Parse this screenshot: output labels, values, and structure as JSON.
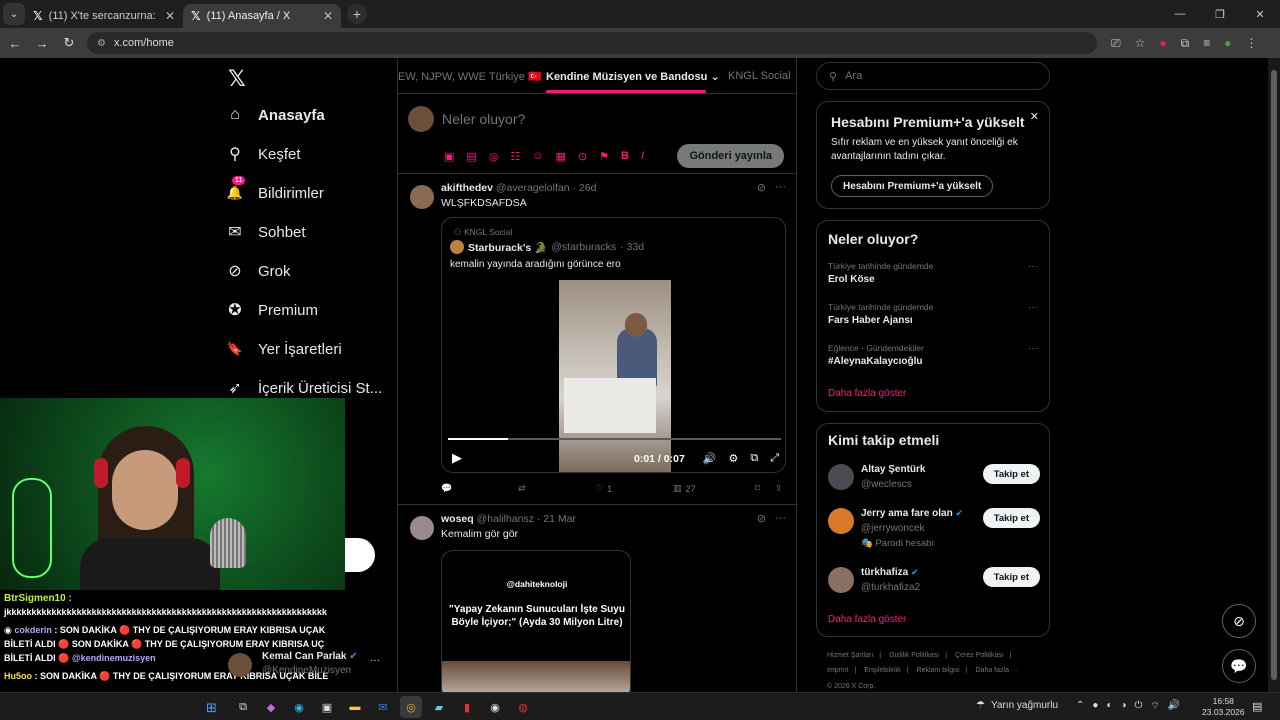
{
  "browser": {
    "tabs": [
      {
        "title": "(11) X'te sercanzurna: \"BEYLER",
        "active": false
      },
      {
        "title": "(11) Anasayfa / X",
        "active": true
      }
    ],
    "address": "x.com/home"
  },
  "nav": {
    "items": [
      {
        "label": "Anasayfa",
        "icon": "home-icon",
        "glyph": "⌂"
      },
      {
        "label": "Keşfet",
        "icon": "search-icon",
        "glyph": "⚲"
      },
      {
        "label": "Bildirimler",
        "icon": "bell-icon",
        "glyph": "🔔"
      },
      {
        "label": "Sohbet",
        "icon": "mail-icon",
        "glyph": "✉"
      },
      {
        "label": "Grok",
        "icon": "grok-icon",
        "glyph": "⊘"
      },
      {
        "label": "Premium",
        "icon": "premium-icon",
        "glyph": "✪"
      },
      {
        "label": "Yer İşaretleri",
        "icon": "bookmark-icon",
        "glyph": "🔖"
      },
      {
        "label": "İçerik Üreticisi St...",
        "icon": "rocket-icon",
        "glyph": "➶"
      }
    ],
    "notifications_badge": "11"
  },
  "feed": {
    "tabs": [
      "EW, NJPW, WWE Türkiye 🇹🇷",
      "Kendine Müzisyen ve Bandosu",
      "KNGL Social"
    ],
    "composer_placeholder": "Neler oluyor?",
    "post_button": "Gönderi yayınla",
    "composer_tools": [
      "▣",
      "▤",
      "◎",
      "☷",
      "☺",
      "▦",
      "⊙",
      "⚑",
      "B",
      "I"
    ],
    "post1": {
      "name": "akifthedev",
      "handle": "@averagelolfan",
      "time": "· 26d",
      "text": "WLŞFKDSAFDSA",
      "quote": {
        "community": "KNGL Social",
        "name": "Starburack's 🐊",
        "handle": "@starburacks",
        "time": "· 33d",
        "text": "kemalin yayında aradığını görünce ero",
        "video_time": "0:01 / 0:07",
        "progress": 0.18
      },
      "replies": "",
      "reposts": "",
      "likes": "1",
      "views": "27"
    },
    "post2": {
      "name": "woseq",
      "handle": "@halilhansz",
      "time": "· 21 Mar",
      "text": "Kemalim gör gör",
      "media_line1": "@dahiteknoloji",
      "media_line2": "\"Yapay Zekanın Sunucuları İşte Suyu Böyle İçiyor;\" (Ayda 30 Milyon Litre)"
    }
  },
  "right": {
    "search_placeholder": "Ara",
    "premium": {
      "title": "Hesabını Premium+'a yükselt",
      "desc": "Sıfır reklam ve en yüksek yanıt önceliği ek avantajlarının tadını çıkar.",
      "button": "Hesabını Premium+'a yükselt"
    },
    "trends": {
      "title": "Neler oluyor?",
      "items": [
        {
          "context": "Türkiye tarihinde gündemde",
          "name": "Erol Köse"
        },
        {
          "context": "Türkiye tarihinde gündemde",
          "name": "Fars Haber Ajansı"
        },
        {
          "context": "Eğlence · Gündemdekiler",
          "name": "#AleynaKalaycıoğlu"
        }
      ],
      "show_more": "Daha fazla göster"
    },
    "who_to_follow": {
      "title": "Kimi takip etmeli",
      "items": [
        {
          "name": "Altay Şentürk",
          "handle": "@weclescs",
          "extra": "",
          "verified": false,
          "button": "Takip et"
        },
        {
          "name": "Jerry ama fare olan",
          "handle": "@jerrywoncek",
          "extra": "🎭 Parodi hesabı",
          "verified": true,
          "button": "Takip et"
        },
        {
          "name": "türkhafiza",
          "handle": "@turkhafiza2",
          "extra": "",
          "verified": true,
          "button": "Takip et"
        }
      ],
      "show_more": "Daha fazla göster"
    },
    "footer": [
      "Hizmet Şartları",
      "|",
      "Gizlilik Politikası",
      "|",
      "Çerez Politikası",
      "|",
      "Imprint",
      "|",
      "Erişilebilirlik",
      "|",
      "Reklam bilgisi",
      "|",
      "Daha fazla ···",
      "© 2026 X Corp."
    ]
  },
  "chat": {
    "lines": [
      {
        "user": "BtrSigmen10 :",
        "text": ""
      },
      {
        "user": "",
        "text": "jkkkkkkkkkkkkkkkkkkkkkkkkkkkkkkkkkkkkkkkkkkkkkkkkkkkkkkkkkkkkkkkk"
      },
      {
        "user": "cokderin",
        "text": ": SON DAKİKA  🔴  THY DE ÇALIŞIYORUM ERAY KIBRISA UÇAK"
      },
      {
        "user": "",
        "text": "BİLETİ ALDI  🔴  SON DAKİKA  🔴  THY DE ÇALIŞIYORUM ERAY KIBRISA UÇ"
      },
      {
        "user": "",
        "text": "BİLETİ ALDI  🔴 ",
        "mention": "@kendinemuzisyen"
      },
      {
        "user": "Hu5oo",
        "text": ": SON DAKİKA  🔴  THY DE ÇALIŞIYORUM ERAY KIBRISA UÇAK BİLE"
      },
      {
        "user": "",
        "text": "ALDI  🔴  SON DAKİKA  🔴  THY DE ÇALIŞIYORUM ERAY KIBRISA UÇAK BİLİ"
      },
      {
        "user": "",
        "text": "ALDI  🔴 ",
        "mention": "@kendinemuzisyen"
      }
    ],
    "overlay_name": "Kemal Can Parlak",
    "overlay_handle": "@KendineMuzisyen"
  },
  "taskbar": {
    "weather": "Yarın yağmurlu",
    "time": "16:58",
    "date": "23.03.2026"
  }
}
